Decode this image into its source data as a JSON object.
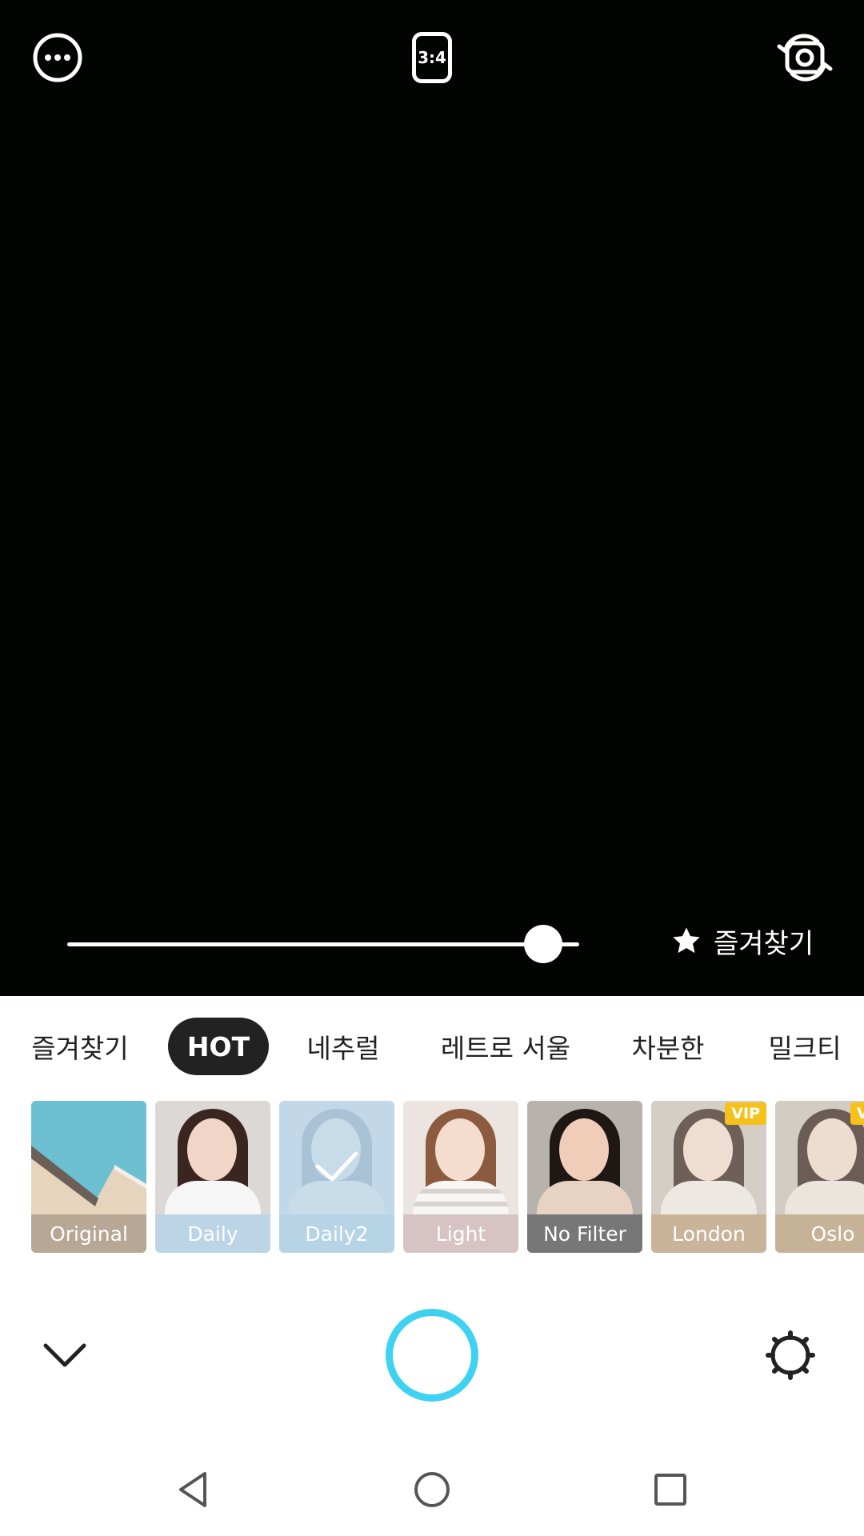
{
  "top_bar": {
    "more_icon": "more-horizontal-icon",
    "ratio_label": "3:4",
    "switch_icon": "switch-camera-icon"
  },
  "intensity": {
    "value": 0.93
  },
  "favorite_button": {
    "label": "즐겨찾기",
    "icon": "star-icon"
  },
  "tabs": [
    {
      "label": "즐겨찾기",
      "active": false
    },
    {
      "label": "HOT",
      "active": true
    },
    {
      "label": "네추럴",
      "active": false
    },
    {
      "label": "레트로 서울",
      "active": false
    },
    {
      "label": "차분한",
      "active": false
    },
    {
      "label": "밀크티",
      "active": false
    }
  ],
  "filters": [
    {
      "label": "Original",
      "label_color": "#b8a795",
      "selected": false,
      "vip": false
    },
    {
      "label": "Daily",
      "label_color": "#bcd5e6",
      "selected": false,
      "vip": false
    },
    {
      "label": "Daily2",
      "label_color": "#b7d3e6",
      "selected": true,
      "vip": false
    },
    {
      "label": "Light",
      "label_color": "#d7c3c4",
      "selected": false,
      "vip": false
    },
    {
      "label": "No Filter",
      "label_color": "#777777",
      "selected": false,
      "vip": false
    },
    {
      "label": "London",
      "label_color": "#c9b49a",
      "selected": false,
      "vip": true,
      "vip_label": "VIP"
    },
    {
      "label": "Oslo",
      "label_color": "#c6b397",
      "selected": false,
      "vip": true,
      "vip_label": "V"
    }
  ],
  "bottom_controls": {
    "collapse_icon": "chevron-down-icon",
    "shutter_color": "#3fd1f2",
    "settings_icon": "settings-gear-icon"
  },
  "navbar": {
    "back_icon": "back-triangle-icon",
    "home_icon": "home-circle-icon",
    "recents_icon": "recents-square-icon"
  }
}
